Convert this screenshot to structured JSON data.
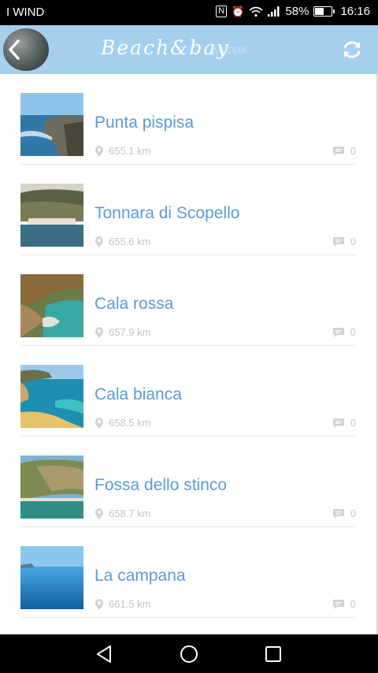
{
  "status_bar": {
    "carrier": "I WIND",
    "nfc_icon": "N",
    "battery": "58%",
    "time": "16:16"
  },
  "header": {
    "brand": "Beach&bay",
    "ghost_text": "Mappa",
    "back_icon": "back-arrow-icon",
    "refresh_icon": "refresh-icon"
  },
  "items": [
    {
      "title": "Punta pispisa",
      "distance": "655.1 km",
      "comments": "0"
    },
    {
      "title": "Tonnara di Scopello",
      "distance": "655.6 km",
      "comments": "0"
    },
    {
      "title": "Cala rossa",
      "distance": "657.9 km",
      "comments": "0"
    },
    {
      "title": "Cala bianca",
      "distance": "658.5 km",
      "comments": "0"
    },
    {
      "title": "Fossa dello stinco",
      "distance": "658.7 km",
      "comments": "0"
    },
    {
      "title": "La campana",
      "distance": "661.5 km",
      "comments": "0"
    }
  ],
  "colors": {
    "header_bg": "#a6cfee",
    "title": "#5b9bd5",
    "meta": "#c4c4c4"
  },
  "nav": {
    "back": "nav-back-icon",
    "home": "nav-home-icon",
    "recents": "nav-recents-icon"
  }
}
